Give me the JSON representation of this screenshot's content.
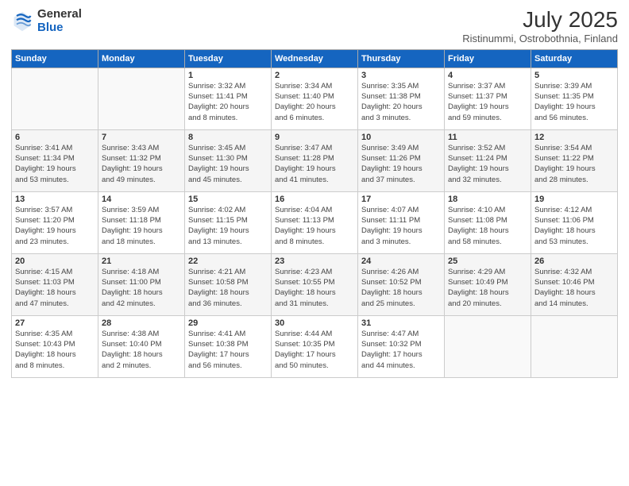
{
  "logo": {
    "general": "General",
    "blue": "Blue"
  },
  "title": "July 2025",
  "location": "Ristinummi, Ostrobothnia, Finland",
  "headers": [
    "Sunday",
    "Monday",
    "Tuesday",
    "Wednesday",
    "Thursday",
    "Friday",
    "Saturday"
  ],
  "rows": [
    [
      {
        "day": "",
        "detail": ""
      },
      {
        "day": "",
        "detail": ""
      },
      {
        "day": "1",
        "detail": "Sunrise: 3:32 AM\nSunset: 11:41 PM\nDaylight: 20 hours\nand 8 minutes."
      },
      {
        "day": "2",
        "detail": "Sunrise: 3:34 AM\nSunset: 11:40 PM\nDaylight: 20 hours\nand 6 minutes."
      },
      {
        "day": "3",
        "detail": "Sunrise: 3:35 AM\nSunset: 11:38 PM\nDaylight: 20 hours\nand 3 minutes."
      },
      {
        "day": "4",
        "detail": "Sunrise: 3:37 AM\nSunset: 11:37 PM\nDaylight: 19 hours\nand 59 minutes."
      },
      {
        "day": "5",
        "detail": "Sunrise: 3:39 AM\nSunset: 11:35 PM\nDaylight: 19 hours\nand 56 minutes."
      }
    ],
    [
      {
        "day": "6",
        "detail": "Sunrise: 3:41 AM\nSunset: 11:34 PM\nDaylight: 19 hours\nand 53 minutes."
      },
      {
        "day": "7",
        "detail": "Sunrise: 3:43 AM\nSunset: 11:32 PM\nDaylight: 19 hours\nand 49 minutes."
      },
      {
        "day": "8",
        "detail": "Sunrise: 3:45 AM\nSunset: 11:30 PM\nDaylight: 19 hours\nand 45 minutes."
      },
      {
        "day": "9",
        "detail": "Sunrise: 3:47 AM\nSunset: 11:28 PM\nDaylight: 19 hours\nand 41 minutes."
      },
      {
        "day": "10",
        "detail": "Sunrise: 3:49 AM\nSunset: 11:26 PM\nDaylight: 19 hours\nand 37 minutes."
      },
      {
        "day": "11",
        "detail": "Sunrise: 3:52 AM\nSunset: 11:24 PM\nDaylight: 19 hours\nand 32 minutes."
      },
      {
        "day": "12",
        "detail": "Sunrise: 3:54 AM\nSunset: 11:22 PM\nDaylight: 19 hours\nand 28 minutes."
      }
    ],
    [
      {
        "day": "13",
        "detail": "Sunrise: 3:57 AM\nSunset: 11:20 PM\nDaylight: 19 hours\nand 23 minutes."
      },
      {
        "day": "14",
        "detail": "Sunrise: 3:59 AM\nSunset: 11:18 PM\nDaylight: 19 hours\nand 18 minutes."
      },
      {
        "day": "15",
        "detail": "Sunrise: 4:02 AM\nSunset: 11:15 PM\nDaylight: 19 hours\nand 13 minutes."
      },
      {
        "day": "16",
        "detail": "Sunrise: 4:04 AM\nSunset: 11:13 PM\nDaylight: 19 hours\nand 8 minutes."
      },
      {
        "day": "17",
        "detail": "Sunrise: 4:07 AM\nSunset: 11:11 PM\nDaylight: 19 hours\nand 3 minutes."
      },
      {
        "day": "18",
        "detail": "Sunrise: 4:10 AM\nSunset: 11:08 PM\nDaylight: 18 hours\nand 58 minutes."
      },
      {
        "day": "19",
        "detail": "Sunrise: 4:12 AM\nSunset: 11:06 PM\nDaylight: 18 hours\nand 53 minutes."
      }
    ],
    [
      {
        "day": "20",
        "detail": "Sunrise: 4:15 AM\nSunset: 11:03 PM\nDaylight: 18 hours\nand 47 minutes."
      },
      {
        "day": "21",
        "detail": "Sunrise: 4:18 AM\nSunset: 11:00 PM\nDaylight: 18 hours\nand 42 minutes."
      },
      {
        "day": "22",
        "detail": "Sunrise: 4:21 AM\nSunset: 10:58 PM\nDaylight: 18 hours\nand 36 minutes."
      },
      {
        "day": "23",
        "detail": "Sunrise: 4:23 AM\nSunset: 10:55 PM\nDaylight: 18 hours\nand 31 minutes."
      },
      {
        "day": "24",
        "detail": "Sunrise: 4:26 AM\nSunset: 10:52 PM\nDaylight: 18 hours\nand 25 minutes."
      },
      {
        "day": "25",
        "detail": "Sunrise: 4:29 AM\nSunset: 10:49 PM\nDaylight: 18 hours\nand 20 minutes."
      },
      {
        "day": "26",
        "detail": "Sunrise: 4:32 AM\nSunset: 10:46 PM\nDaylight: 18 hours\nand 14 minutes."
      }
    ],
    [
      {
        "day": "27",
        "detail": "Sunrise: 4:35 AM\nSunset: 10:43 PM\nDaylight: 18 hours\nand 8 minutes."
      },
      {
        "day": "28",
        "detail": "Sunrise: 4:38 AM\nSunset: 10:40 PM\nDaylight: 18 hours\nand 2 minutes."
      },
      {
        "day": "29",
        "detail": "Sunrise: 4:41 AM\nSunset: 10:38 PM\nDaylight: 17 hours\nand 56 minutes."
      },
      {
        "day": "30",
        "detail": "Sunrise: 4:44 AM\nSunset: 10:35 PM\nDaylight: 17 hours\nand 50 minutes."
      },
      {
        "day": "31",
        "detail": "Sunrise: 4:47 AM\nSunset: 10:32 PM\nDaylight: 17 hours\nand 44 minutes."
      },
      {
        "day": "",
        "detail": ""
      },
      {
        "day": "",
        "detail": ""
      }
    ]
  ]
}
